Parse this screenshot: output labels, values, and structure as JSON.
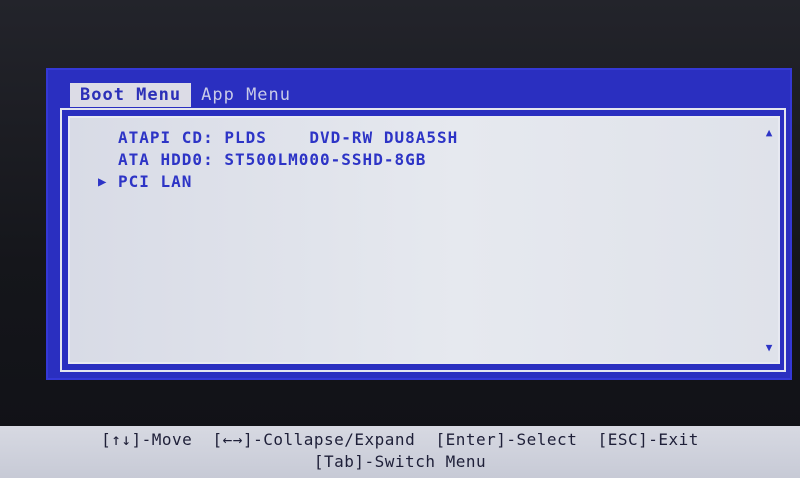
{
  "tabs": [
    {
      "label": "Boot Menu",
      "active": true
    },
    {
      "label": "App Menu",
      "active": false
    }
  ],
  "boot_entries": [
    {
      "label": "ATAPI CD: PLDS    DVD-RW DU8A5SH",
      "selected": false
    },
    {
      "label": "ATA HDD0: ST500LM000-SSHD-8GB",
      "selected": false
    },
    {
      "label": "PCI LAN",
      "selected": true
    }
  ],
  "selection_marker": "▶",
  "scroll": {
    "up_icon": "▲",
    "down_icon": "▼"
  },
  "help": {
    "line1": "[↑↓]-Move  [←→]-Collapse/Expand  [Enter]-Select  [ESC]-Exit",
    "line2": "[Tab]-Switch Menu"
  },
  "colors": {
    "dialog_blue": "#2a2fc0",
    "text_blue": "#2d34c6",
    "panel": "#e0e3ec",
    "help_bar": "#cfd2dc"
  }
}
